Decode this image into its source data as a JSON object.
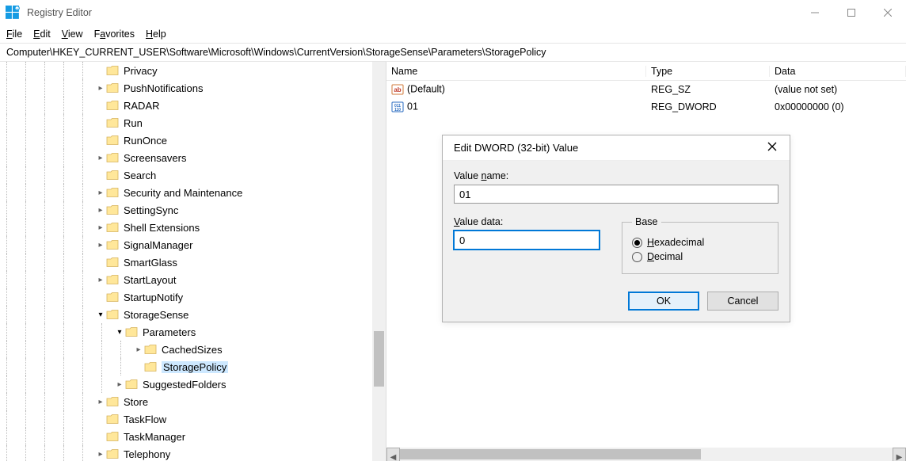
{
  "window": {
    "title": "Registry Editor",
    "address": "Computer\\HKEY_CURRENT_USER\\Software\\Microsoft\\Windows\\CurrentVersion\\StorageSense\\Parameters\\StoragePolicy"
  },
  "menus": {
    "file": "File",
    "edit": "Edit",
    "view": "View",
    "favorites": "Favorites",
    "help": "Help"
  },
  "tree": {
    "items": [
      {
        "indent": 5,
        "exp": "",
        "label": "Privacy"
      },
      {
        "indent": 5,
        "exp": ">",
        "label": "PushNotifications"
      },
      {
        "indent": 5,
        "exp": "",
        "label": "RADAR"
      },
      {
        "indent": 5,
        "exp": "",
        "label": "Run"
      },
      {
        "indent": 5,
        "exp": "",
        "label": "RunOnce"
      },
      {
        "indent": 5,
        "exp": ">",
        "label": "Screensavers"
      },
      {
        "indent": 5,
        "exp": "",
        "label": "Search"
      },
      {
        "indent": 5,
        "exp": ">",
        "label": "Security and Maintenance"
      },
      {
        "indent": 5,
        "exp": ">",
        "label": "SettingSync"
      },
      {
        "indent": 5,
        "exp": ">",
        "label": "Shell Extensions"
      },
      {
        "indent": 5,
        "exp": ">",
        "label": "SignalManager"
      },
      {
        "indent": 5,
        "exp": "",
        "label": "SmartGlass"
      },
      {
        "indent": 5,
        "exp": ">",
        "label": "StartLayout"
      },
      {
        "indent": 5,
        "exp": "",
        "label": "StartupNotify"
      },
      {
        "indent": 5,
        "exp": "v",
        "label": "StorageSense"
      },
      {
        "indent": 6,
        "exp": "v",
        "label": "Parameters"
      },
      {
        "indent": 7,
        "exp": ">",
        "label": "CachedSizes"
      },
      {
        "indent": 7,
        "exp": "",
        "label": "StoragePolicy",
        "selected": true
      },
      {
        "indent": 6,
        "exp": ">",
        "label": "SuggestedFolders"
      },
      {
        "indent": 5,
        "exp": ">",
        "label": "Store"
      },
      {
        "indent": 5,
        "exp": "",
        "label": "TaskFlow"
      },
      {
        "indent": 5,
        "exp": "",
        "label": "TaskManager"
      },
      {
        "indent": 5,
        "exp": ">",
        "label": "Telephony"
      }
    ]
  },
  "columns": {
    "name": "Name",
    "type": "Type",
    "data": "Data"
  },
  "values": [
    {
      "icon": "sz",
      "name": "(Default)",
      "type": "REG_SZ",
      "data": "(value not set)"
    },
    {
      "icon": "dw",
      "name": "01",
      "type": "REG_DWORD",
      "data": "0x00000000 (0)"
    }
  ],
  "dialog": {
    "title": "Edit DWORD (32-bit) Value",
    "value_name_label": "Value name:",
    "value_name": "01",
    "value_data_label": "Value data:",
    "value_data": "0",
    "base_label": "Base",
    "hex_label": "Hexadecimal",
    "dec_label": "Decimal",
    "ok": "OK",
    "cancel": "Cancel"
  }
}
